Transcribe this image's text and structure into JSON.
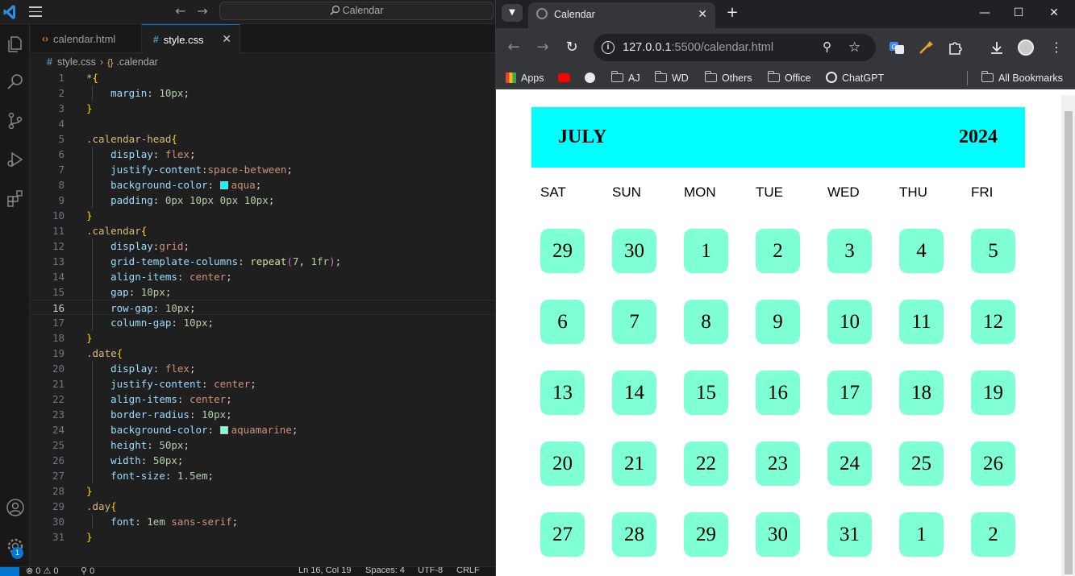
{
  "vscode": {
    "search_placeholder": "Calendar",
    "tabs": [
      {
        "label": "calendar.html",
        "icon": "html-file-icon"
      },
      {
        "label": "style.css",
        "icon": "css-file-icon"
      }
    ],
    "breadcrumb": {
      "file": "style.css",
      "symbol": ".calendar"
    },
    "code_lines": [
      "*{",
      "    margin: 10px;",
      "}",
      "",
      ".calendar-head{",
      "    display: flex;",
      "    justify-content:space-between;",
      "    background-color: aqua;",
      "    padding: 0px 10px 0px 10px;",
      "}",
      ".calendar{",
      "    display:grid;",
      "    grid-template-columns: repeat(7, 1fr);",
      "    align-items: center;",
      "    gap: 10px;",
      "    row-gap: 10px;",
      "    column-gap: 10px;",
      "}",
      ".date{",
      "    display: flex;",
      "    justify-content: center;",
      "    align-items: center;",
      "    border-radius: 10px;",
      "    background-color: aquamarine;",
      "    height: 50px;",
      "    width: 50px;",
      "    font-size: 1.5em;",
      "}",
      ".day{",
      "    font: 1em sans-serif;",
      "}"
    ],
    "current_line": 16,
    "status": {
      "problems_errors": "0",
      "problems_warnings": "0",
      "ports": "0",
      "position": "Ln 16, Col 19",
      "spaces": "Spaces: 4",
      "encoding": "UTF-8",
      "eol": "CRLF"
    },
    "accounts_badge": "1"
  },
  "browser": {
    "tab_title": "Calendar",
    "url_host": "127.0.0.1",
    "url_rest": ":5500/calendar.html",
    "bookmarks": [
      "Apps",
      "AJ",
      "WD",
      "Others",
      "Office",
      "ChatGPT"
    ],
    "all_bookmarks": "All Bookmarks"
  },
  "calendar": {
    "month": "JULY",
    "year": "2024",
    "days": [
      "SAT",
      "SUN",
      "MON",
      "TUE",
      "WED",
      "THU",
      "FRI"
    ],
    "dates": [
      [
        "29",
        "30",
        "1",
        "2",
        "3",
        "4",
        "5"
      ],
      [
        "6",
        "7",
        "8",
        "9",
        "10",
        "11",
        "12"
      ],
      [
        "13",
        "14",
        "15",
        "16",
        "17",
        "18",
        "19"
      ],
      [
        "20",
        "21",
        "22",
        "23",
        "24",
        "25",
        "26"
      ],
      [
        "27",
        "28",
        "29",
        "30",
        "31",
        "1",
        "2"
      ]
    ],
    "colors": {
      "head_bg": "#00ffff",
      "date_bg": "#7fffd4"
    }
  }
}
